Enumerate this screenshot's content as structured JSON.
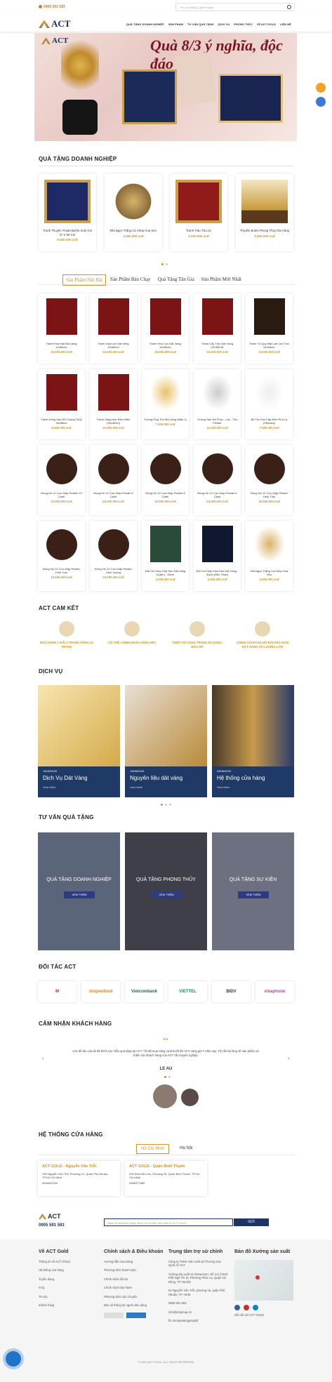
{
  "header": {
    "hotline": "0905 591 593",
    "search_placeholder": "Tìm quà tặng ý nghĩa ngay!",
    "logo": "ACT",
    "menu": [
      "QUÀ TẶNG DOANH NGHIỆP",
      "SẢN PHẨM",
      "TƯ VẤN QUÀ TẶNG",
      "DỊCH VỤ",
      "PHONG THỦY",
      "VỀ ACT GOLD",
      "LIÊN HỆ"
    ]
  },
  "hero": {
    "slogan": "Quà 8/3 ý nghĩa, độc đáo",
    "logo": "ACT"
  },
  "gifts": {
    "title": "QUÀ TẶNG DOANH NGHIỆP",
    "items": [
      {
        "name": "Tranh Thuyền Thuận Buồm Xuôi Gió 37 X 50 Cm",
        "price": "5.500.000 vnđ"
      },
      {
        "name": "Đĩa Ngọc Trắng Cá Chép Hoa Sen",
        "price": "4.000.000 vnđ"
      },
      {
        "name": "Tranh Trâu Tài Lộc",
        "price": "5.500.000 vnđ"
      },
      {
        "name": "Thuyền Buồm Phong Thủy Dát Vàng",
        "price": "9.500.000 vnđ"
      }
    ]
  },
  "tabs": [
    "Sản Phẩm Nổi Bật",
    "Sản Phẩm Bán Chạy",
    "Quà Tặng Tân Gia",
    "Sản Phẩm Mới Nhất"
  ],
  "products": [
    {
      "name": "Tranh Hoa Mai Đôi Vàng 42x60cm",
      "price": "10.000.000 vnđ"
    },
    {
      "name": "Tranh Hoa Lan Dát Vàng 42x60cm",
      "price": "10.000.000 vnđ"
    },
    {
      "name": "Tranh Hoa Cúc Dát Vàng 42x60cm",
      "price": "10.000.000 vnđ"
    },
    {
      "name": "Tranh Cây Trúc Dát Vàng 42X60CM",
      "price": "10.000.000 vnđ"
    },
    {
      "name": "Tranh Tứ Quý Mai Lan Cúc Trúc 61x26cm",
      "price": "10.000.000 vnđ"
    },
    {
      "name": "Tranh Vàng Hạc Đỏ Chung Thủy 38x38cm",
      "price": "6.500.000 vnđ"
    },
    {
      "name": "Tranh Vàng Hạc Điện Niên (30x30cm)",
      "price": "10.000.000 vnđ"
    },
    {
      "name": "Tượng Ông Thọ Mạ Vàng (Mẫu 1)",
      "price": "7.000.000 vnđ"
    },
    {
      "name": "Tượng Tam Đa Phúc - Lộc - Thọ Pewter",
      "price": "11.000.000 vnđ"
    },
    {
      "name": "Bộ Trà Cao Cấp Bình Phú Lộ (Vietnam)",
      "price": "7.500.000 vnđ"
    },
    {
      "name": "Đồng Hồ 12 Con Giáp Pewter 12 Canh",
      "price": "23.000.000 vnđ"
    },
    {
      "name": "Đồng Hồ 12 Con Giáp Pewter 5 Canh",
      "price": "23.000.000 vnđ"
    },
    {
      "name": "Đồng Hồ 12 Con Giáp Pewter 8 Canh",
      "price": "23.000.000 vnđ"
    },
    {
      "name": "Đồng Hồ 12 Con Giáp Pewter 6 Canh",
      "price": "23.000.000 vnđ"
    },
    {
      "name": "Đồng Hồ 12 Con Giáp Pewter Hình Thoi",
      "price": "23.000.000 vnđ"
    },
    {
      "name": "Đồng Hồ 12 Con Giáp Pewter Hình Tròn",
      "price": "23.000.000 vnđ"
    },
    {
      "name": "Đồng Hồ 12 Con Giáp Pewter Hình Vuông",
      "price": "23.000.000 vnđ"
    },
    {
      "name": "Đĩa Cá Chép Hoa Sen Dát Vàng (Xanh) - 30cm",
      "price": "4.000.000 vnđ"
    },
    {
      "name": "Đĩa Cá Chép Hoa Sen Dát Vàng - 30cm (Đen Than)",
      "price": "4.000.000 vnđ"
    },
    {
      "name": "Đĩa Ngọc Trắng Cá Chép Hoa Sen",
      "price": "4.000.000 vnđ"
    }
  ],
  "commit": {
    "title": "ACT CAM KẾT",
    "items": [
      "BẢO HÀNH 1 ĐỔI 1 TRONG VÒNG 24 THÁNG",
      "CÓ THỂ CHỈNH NHÂN VÀNG 99%",
      "THIẾT KẾ SANG TRỌNG ĐA DẠNG MẪU MÃ",
      "CHÍNH SÁCH GIA ƯU ĐÃI CHO ĐƠN ĐẶT HÀNG SỐ LƯỢNG LỚN"
    ]
  },
  "services": {
    "title": "DỊCH VỤ",
    "items": [
      {
        "date": "15/06/2020",
        "title": "Dịch Vụ Dát Vàng",
        "more": "Xem thêm"
      },
      {
        "date": "15/06/2020",
        "title": "Nguyên liệu dát vàng",
        "more": "Xem thêm"
      },
      {
        "date": "09/06/2020",
        "title": "Hệ thống cửa hàng",
        "more": "Xem thêm"
      }
    ]
  },
  "consult": {
    "title": "TƯ VẤN QUÀ TẶNG",
    "items": [
      {
        "title": "QUÀ TẶNG DOANH NGHIỆP",
        "btn": "XEM THÊM"
      },
      {
        "title": "QUÀ TẶNG PHONG THỦY",
        "btn": "XEM THÊM"
      },
      {
        "title": "QUÀ TẶNG SỰ KIỆN",
        "btn": "XEM THÊM"
      }
    ]
  },
  "partners": {
    "title": "ĐỐI TÁC ACT",
    "items": [
      "M",
      "shopeefood",
      "Vietcombank",
      "VIETTEL",
      "BIDV",
      "vinaphone"
    ]
  },
  "reviews": {
    "title": "CẢM NHẬN KHÁCH HÀNG",
    "quote_mark": "❝❝",
    "text": "Các đồ láo của tôi đã thích các mẫu quà tặng tại ACT. Tôi đã mua nâng và khá tốt khi ACT vàng giá 7 năm nay. Tôi rất hài lòng về sản phẩm và chăm sóc khách hàng của ACT rất chuyên nghiệp.",
    "name": "LE AU"
  },
  "stores": {
    "title": "HỆ THỐNG CỬA HÀNG",
    "tabs": [
      "Hồ Chí Minh",
      "Hà Nội"
    ],
    "items": [
      {
        "name": "ACT GOLD - Nguyễn Văn Trỗi",
        "address": "199 Nguyễn Văn Trỗi, Phường 10, Quận Phú Nhuận, TP.Hồ Chí Minh",
        "phone": "0945042020"
      },
      {
        "name": "ACT GOLD - Quận Bình Thạnh",
        "address": "239 Đinh Bộ Lĩnh, Phường 26, Quận Bình Thạnh, TP.Hồ Chí Minh",
        "phone": "0966977850"
      }
    ]
  },
  "newsletter": {
    "logo": "ACT",
    "phone": "0905 591 593",
    "placeholder": "Nhập Email nhận ngay thông tin ưu đãi mới nhất từ ACT GOLD",
    "btn": "GỬI"
  },
  "footer": {
    "col1": {
      "title": "Về ACT Gold",
      "items": [
        "Thông tin về ACT GOLD",
        "Hệ thống cửa hàng",
        "Tuyển dụng",
        "FAQ",
        "Tin tức",
        "Khách hàng"
      ]
    },
    "col2": {
      "title": "Chính sách & Điều khoản",
      "items": [
        "Hướng dẫn mua hàng",
        "Phương thức thanh toán",
        "Chính sách đổi trả",
        "Chính sách bảo hành",
        "Phương thức vận chuyển",
        "Bảo vệ thông tin người tiêu dùng"
      ]
    },
    "col3": {
      "title": "Trung tâm trợ sử chính",
      "items": [
        "Công ty TNHH Sản xuất và Thương mại Quốc tế ACT",
        "Xưởng sản xuất và Showroom: Số 14 Lô B19 Phố Ngô Thì Sĩ, Phường Phúc La, Quận Hà Đông, TP Hà Nội",
        "53 Nguyễn Văn Trỗi, phường 15, quận Phú Nhuận, TP. HCM",
        "0905 591 593",
        "info@actgroup.vn",
        "fb.com/quatangactgold"
      ]
    },
    "col4": {
      "title": "Bản đồ Xưởng sản xuất",
      "note": "Kết nối với ACT GOLD"
    },
    "copyright": "© 2022 ACT GOLD. ALL RIGHT RESERVED"
  },
  "colors": {
    "gold": "#c8952a",
    "navy": "#1f3366"
  }
}
